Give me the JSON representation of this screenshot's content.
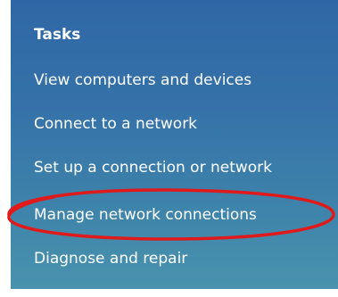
{
  "panel": {
    "heading": "Tasks",
    "tasks": [
      {
        "label": "View computers and devices"
      },
      {
        "label": "Connect to a network"
      },
      {
        "label": "Set up a connection or network"
      },
      {
        "label": "Manage network connections",
        "highlighted": true
      },
      {
        "label": "Diagnose and repair"
      }
    ]
  },
  "colors": {
    "panel_top": "#2f67a6",
    "panel_bottom": "#4a93ae",
    "text": "#ffffff",
    "highlight_ellipse": "#e01a1a"
  }
}
